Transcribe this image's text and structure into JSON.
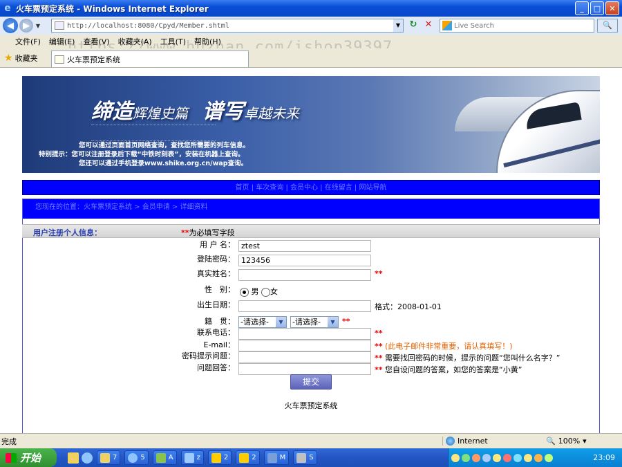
{
  "window": {
    "title": "火车票预定系统 - Windows Internet Explorer",
    "minimize": "_",
    "maximize": "□",
    "close": "✕"
  },
  "address_bar": {
    "url": "http://localhost:8080/Cpyd/Member.shtml",
    "search_placeholder": "Live Search"
  },
  "menu": [
    "文件(F)",
    "编辑(E)",
    "查看(V)",
    "收藏夹(A)",
    "工具(T)",
    "帮助(H)"
  ],
  "watermark": "https://www.huzhan.com/ishop39397",
  "favorites": {
    "label": "收藏夹",
    "tab_title": "火车票预定系统"
  },
  "banner": {
    "slogan_a": "缔造",
    "slogan_a_small": "辉煌史篇",
    "slogan_b": "谱写",
    "slogan_b_small": "卓越未来",
    "note1": "您可以通过页面首页网络查询，查找您所需要的列车信息。",
    "note2_prefix": "特别提示：",
    "note2": "您可以注册登录后下载“中铁时刻表”，安装在机器上查询。",
    "note3": "您还可以通过手机登录www.shike.org.cn/wap查询。"
  },
  "nav": "首页 | 车次查询 | 会员中心 | 在线留言 | 网站导航",
  "breadcrumb": "您现在的位置：火车票预定系统 > 会员申请 > 详细资料",
  "section": {
    "title": "用户注册个人信息：",
    "required_stars": "**",
    "required_note": "为必填写字段"
  },
  "form": {
    "username_label": "用 户 名：",
    "username_value": "ztest",
    "password_label": "登陆密码：",
    "password_value": "123456",
    "realname_label": "真实姓名：",
    "gender_label": "性　别：",
    "gender_male": "男",
    "gender_female": "女",
    "birthday_label": "出生日期：",
    "birthday_hint": "格式：2008-01-01",
    "native_label": "籍　贯：",
    "province_option": "-请选择-",
    "city_option": "-请选择-",
    "phone_label": "联系电话：",
    "email_label": "E-mail：",
    "email_hint": "(此电子邮件非常重要，请认真填写！)",
    "question_label": "密码提示问题：",
    "question_hint": "需要找回密码的时候，提示的问题“您叫什么名字？”",
    "answer_label": "问题回答：",
    "answer_hint": "您自设问题的答案，如您的答案是“小黄”",
    "star": "**",
    "submit": "提交"
  },
  "footer": "火车票预定系统",
  "status": {
    "text": "完成",
    "zone": "Internet",
    "zoom": "100%"
  },
  "taskbar": {
    "start": "开始",
    "tasks": [
      "7",
      "5",
      "A",
      "z",
      "2",
      "2",
      "M",
      "S"
    ],
    "clock": "23:09"
  }
}
